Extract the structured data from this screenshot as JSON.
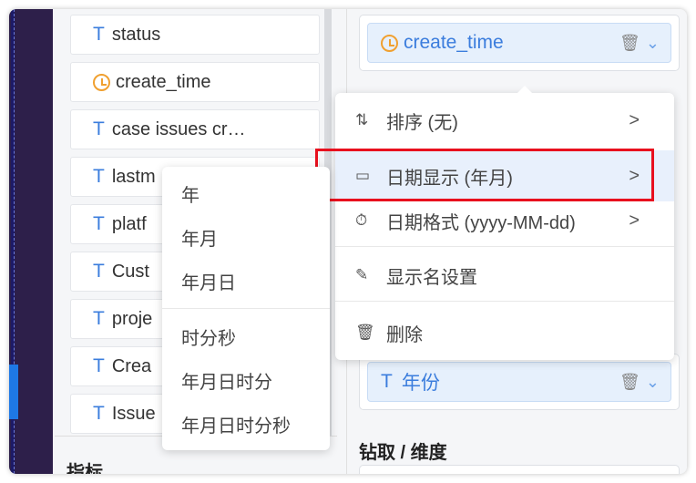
{
  "fields": [
    {
      "type": "text",
      "label": "status"
    },
    {
      "type": "date",
      "label": "create_time"
    },
    {
      "type": "text",
      "label": "case issues cr…"
    },
    {
      "type": "text",
      "label": "lastm"
    },
    {
      "type": "text",
      "label": "platf"
    },
    {
      "type": "text",
      "label": "Cust"
    },
    {
      "type": "text",
      "label": "proje"
    },
    {
      "type": "text",
      "label": "Crea"
    },
    {
      "type": "text",
      "label": "Issue"
    }
  ],
  "metrics_label": "指标",
  "right": {
    "dim1": "create_time",
    "dim2": "年份",
    "drill_label": "钻取 / 维度",
    "type_glyph": "T"
  },
  "menu": [
    {
      "icon": "sort-icon",
      "glyph": "⇅",
      "label": "排序 (无)",
      "arrow": ">"
    },
    {
      "icon": "calendar-icon",
      "glyph": "▭",
      "label": "日期显示 (年月)",
      "arrow": ">"
    },
    {
      "icon": "stopwatch-icon",
      "glyph": "⏱",
      "label": "日期格式 (yyyy-MM-dd)",
      "arrow": ">"
    },
    {
      "icon": "edit-icon",
      "glyph": "✎",
      "label": "显示名设置"
    },
    {
      "icon": "trash-icon",
      "glyph": "🗑",
      "label": "删除"
    }
  ],
  "submenu": [
    "年",
    "年月",
    "年月日",
    "时分秒",
    "年月日时分",
    "年月日时分秒"
  ],
  "colors": {
    "accent": "#3b7ddd",
    "highlight": "#e8101e",
    "date": "#f0a030"
  }
}
